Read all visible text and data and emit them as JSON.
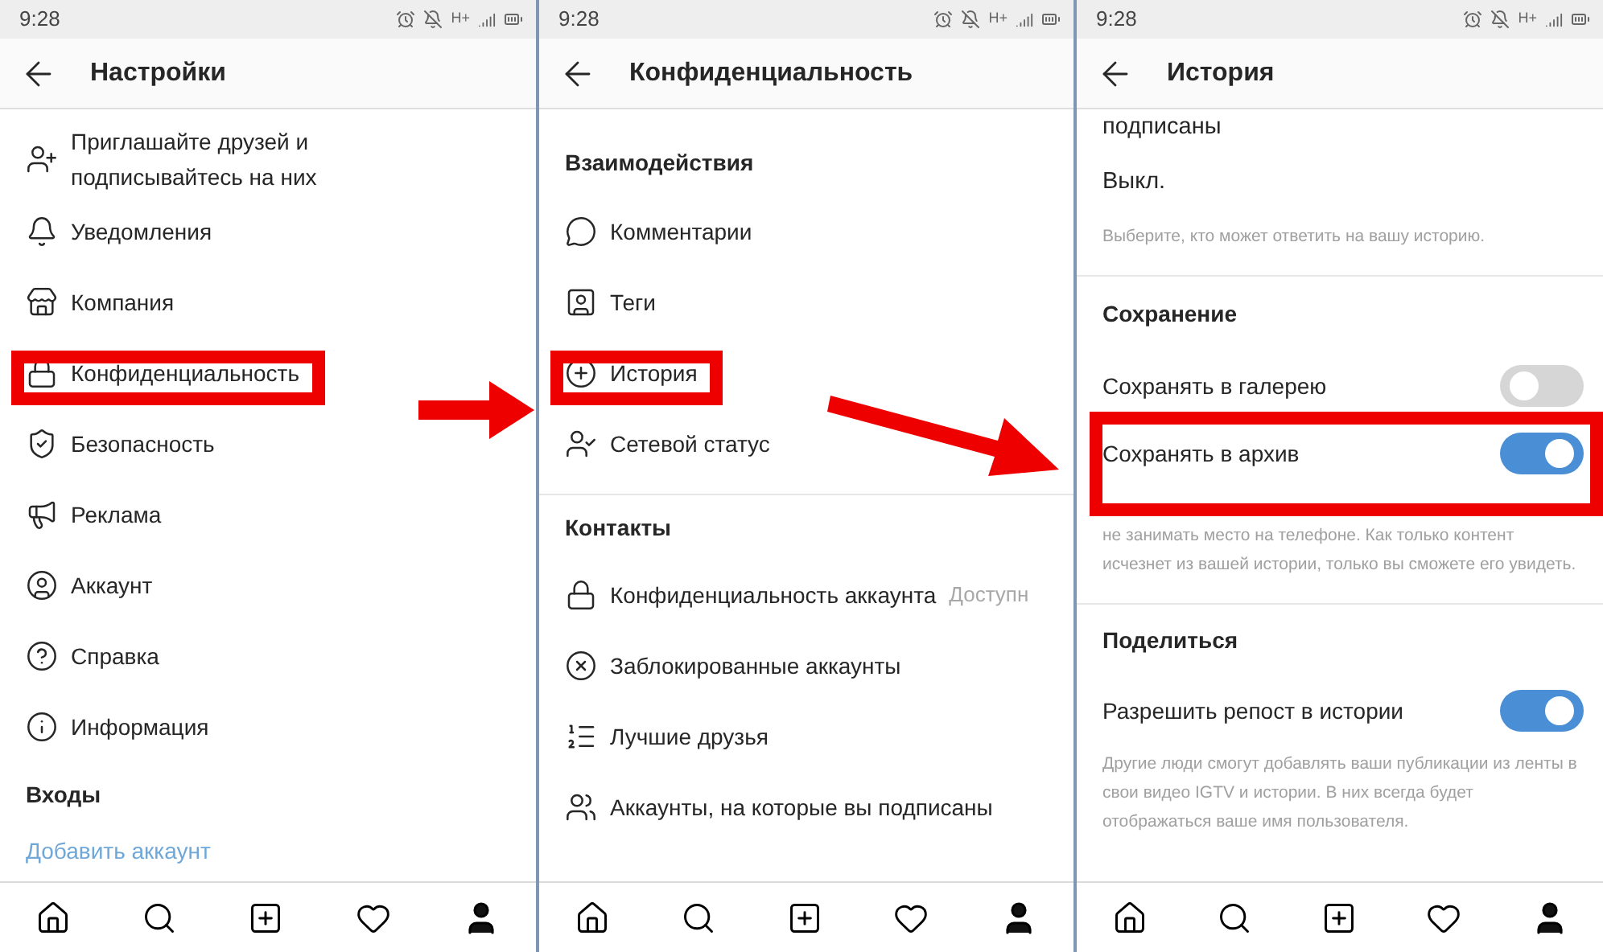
{
  "screens": [
    {
      "status": {
        "time": "9:28",
        "network": "H+"
      },
      "title": "Настройки",
      "rows": [
        {
          "kind": "item",
          "label": "Приглашайте друзей и подписывайтесь на них",
          "highlighted": false
        },
        {
          "kind": "item",
          "label": "Уведомления",
          "highlighted": false
        },
        {
          "kind": "item",
          "label": "Компания",
          "highlighted": false
        },
        {
          "kind": "item",
          "label": "Конфиденциальность",
          "highlighted": true
        },
        {
          "kind": "item",
          "label": "Безопасность",
          "highlighted": false
        },
        {
          "kind": "item",
          "label": "Реклама",
          "highlighted": false
        },
        {
          "kind": "item",
          "label": "Аккаунт",
          "highlighted": false
        },
        {
          "kind": "item",
          "label": "Справка",
          "highlighted": false
        },
        {
          "kind": "item",
          "label": "Информация",
          "highlighted": false
        },
        {
          "kind": "section",
          "label": "Входы"
        },
        {
          "kind": "link",
          "label": "Добавить аккаунт"
        }
      ]
    },
    {
      "status": {
        "time": "9:28",
        "network": "H+"
      },
      "title": "Конфиденциальность",
      "rows": [
        {
          "kind": "section",
          "label": "Взаимодействия"
        },
        {
          "kind": "item",
          "label": "Комментарии",
          "highlighted": false
        },
        {
          "kind": "item",
          "label": "Теги",
          "highlighted": false
        },
        {
          "kind": "item",
          "label": "История",
          "highlighted": true
        },
        {
          "kind": "item",
          "label": "Сетевой статус",
          "highlighted": false
        },
        {
          "kind": "divider"
        },
        {
          "kind": "section",
          "label": "Контакты"
        },
        {
          "kind": "item",
          "label": "Конфиденциальность аккаунта",
          "value": "Доступн",
          "highlighted": false
        },
        {
          "kind": "item",
          "label": "Заблокированные аккаунты",
          "highlighted": false
        },
        {
          "kind": "item",
          "label": "Лучшие друзья",
          "highlighted": false
        },
        {
          "kind": "item",
          "label": "Аккаунты, на которые вы подписаны",
          "highlighted": false
        }
      ]
    },
    {
      "status": {
        "time": "9:28",
        "network": "H+"
      },
      "title": "История",
      "rows": [
        {
          "kind": "text",
          "label": "подписаны"
        },
        {
          "kind": "text",
          "label": "Выкл."
        },
        {
          "kind": "hint",
          "label": "Выберите, кто может ответить на вашу историю."
        },
        {
          "kind": "divider"
        },
        {
          "kind": "section",
          "label": "Сохранение"
        },
        {
          "kind": "toggle",
          "label": "Сохранять в галерею",
          "on": false,
          "highlighted": false
        },
        {
          "kind": "toggle",
          "label": "Сохранять в архив",
          "on": true,
          "highlighted": true
        },
        {
          "kind": "hint",
          "label": "не занимать место на телефоне. Как только контент исчезнет из вашей истории, только вы сможете его увидеть."
        },
        {
          "kind": "divider"
        },
        {
          "kind": "section",
          "label": "Поделиться"
        },
        {
          "kind": "toggle",
          "label": "Разрешить репост в истории",
          "on": true,
          "highlighted": false
        },
        {
          "kind": "hint",
          "label": "Другие люди смогут добавлять ваши публикации из ленты в свои видео IGTV и истории. В них всегда будет отображаться ваше имя пользователя."
        }
      ]
    }
  ]
}
